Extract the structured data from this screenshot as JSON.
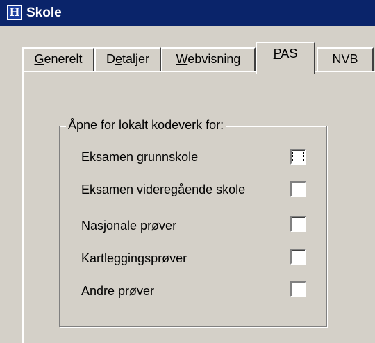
{
  "window": {
    "title": "Skole",
    "icon": "school-app-icon",
    "icon_glyph": "H"
  },
  "tabs": [
    {
      "label_acc": "G",
      "label_rest": "enerelt",
      "active": false
    },
    {
      "label_pre": "D",
      "label_acc": "e",
      "label_rest": "taljer",
      "active": false
    },
    {
      "label_acc": "W",
      "label_rest": "ebvisning",
      "active": false
    },
    {
      "label_acc": "P",
      "label_rest": "AS",
      "active": true
    },
    {
      "label_rest": "NVB",
      "active": false
    }
  ],
  "group": {
    "legend": "Åpne for lokalt kodeverk for:",
    "options": [
      {
        "label": "Eksamen grunnskole",
        "checked": false,
        "focused": true
      },
      {
        "label": "Eksamen videregående skole",
        "checked": false,
        "focused": false
      },
      {
        "label": "Nasjonale prøver",
        "checked": false,
        "focused": false
      },
      {
        "label": "Kartleggingsprøver",
        "checked": false,
        "focused": false
      },
      {
        "label": "Andre prøver",
        "checked": false,
        "focused": false
      }
    ]
  },
  "colors": {
    "titlebar": "#0a246a",
    "dialog_face": "#d4d0c8"
  }
}
